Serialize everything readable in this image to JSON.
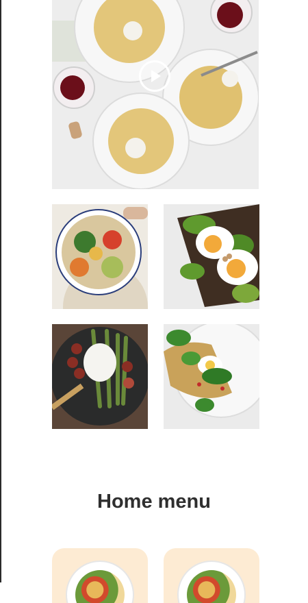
{
  "hero": {
    "image": "pasta-plates-with-red-wine-photo",
    "play_icon": "play-icon"
  },
  "gallery": [
    {
      "image": "grain-and-roasted-vegetable-bowl-photo"
    },
    {
      "image": "avocado-toast-with-egg-photo"
    },
    {
      "image": "asparagus-and-poached-egg-plate-photo"
    },
    {
      "image": "spinach-toast-with-egg-photo"
    }
  ],
  "menu_section": {
    "title": "Home menu"
  },
  "menu_cards": [
    {
      "image": "menu-dish-photo-1"
    },
    {
      "image": "menu-dish-photo-2"
    }
  ],
  "colors": {
    "title_text": "#2f2f2f",
    "menu_card_bg": "#fdebd3",
    "photo_bg": "#efefef"
  }
}
